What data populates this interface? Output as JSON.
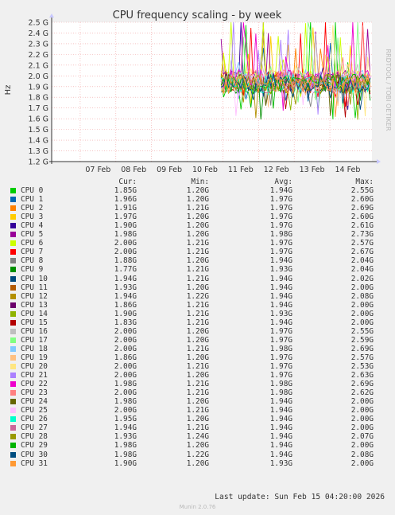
{
  "chart_data": {
    "type": "line",
    "title": "CPU frequency scaling - by week",
    "ylabel": "Hz",
    "side_text": "RRDTOOL / TOBI OETIKER",
    "x_ticks": [
      "07 Feb",
      "08 Feb",
      "09 Feb",
      "10 Feb",
      "11 Feb",
      "12 Feb",
      "13 Feb",
      "14 Feb"
    ],
    "y_ticks": [
      "1.2 G",
      "1.3 G",
      "1.4 G",
      "1.5 G",
      "1.6 G",
      "1.7 G",
      "1.8 G",
      "1.9 G",
      "2.0 G",
      "2.1 G",
      "2.2 G",
      "2.3 G",
      "2.4 G",
      "2.5 G"
    ],
    "ylim": [
      1.2,
      2.5
    ],
    "xlim_days": [
      6.2,
      15.18
    ],
    "data_start_day": 10.95,
    "grid": true,
    "series": [
      {
        "name": "CPU 0",
        "color": "#00cc00",
        "cur": "1.85G",
        "min": "1.20G",
        "avg": "1.94G",
        "max": "2.55G"
      },
      {
        "name": "CPU 1",
        "color": "#0066b3",
        "cur": "1.96G",
        "min": "1.20G",
        "avg": "1.97G",
        "max": "2.60G"
      },
      {
        "name": "CPU 2",
        "color": "#ff8000",
        "cur": "1.91G",
        "min": "1.21G",
        "avg": "1.97G",
        "max": "2.69G"
      },
      {
        "name": "CPU 3",
        "color": "#ffcc00",
        "cur": "1.97G",
        "min": "1.20G",
        "avg": "1.97G",
        "max": "2.60G"
      },
      {
        "name": "CPU 4",
        "color": "#330099",
        "cur": "1.90G",
        "min": "1.20G",
        "avg": "1.97G",
        "max": "2.61G"
      },
      {
        "name": "CPU 5",
        "color": "#990099",
        "cur": "1.98G",
        "min": "1.20G",
        "avg": "1.98G",
        "max": "2.73G"
      },
      {
        "name": "CPU 6",
        "color": "#ccff00",
        "cur": "2.00G",
        "min": "1.21G",
        "avg": "1.97G",
        "max": "2.57G"
      },
      {
        "name": "CPU 7",
        "color": "#ff0000",
        "cur": "2.00G",
        "min": "1.21G",
        "avg": "1.97G",
        "max": "2.67G"
      },
      {
        "name": "CPU 8",
        "color": "#808080",
        "cur": "1.88G",
        "min": "1.20G",
        "avg": "1.94G",
        "max": "2.04G"
      },
      {
        "name": "CPU 9",
        "color": "#008f00",
        "cur": "1.77G",
        "min": "1.21G",
        "avg": "1.93G",
        "max": "2.04G"
      },
      {
        "name": "CPU 10",
        "color": "#00487d",
        "cur": "1.94G",
        "min": "1.21G",
        "avg": "1.94G",
        "max": "2.02G"
      },
      {
        "name": "CPU 11",
        "color": "#b35a00",
        "cur": "1.93G",
        "min": "1.20G",
        "avg": "1.94G",
        "max": "2.00G"
      },
      {
        "name": "CPU 12",
        "color": "#b38f00",
        "cur": "1.94G",
        "min": "1.22G",
        "avg": "1.94G",
        "max": "2.08G"
      },
      {
        "name": "CPU 13",
        "color": "#6b006b",
        "cur": "1.86G",
        "min": "1.21G",
        "avg": "1.94G",
        "max": "2.00G"
      },
      {
        "name": "CPU 14",
        "color": "#8fb300",
        "cur": "1.90G",
        "min": "1.21G",
        "avg": "1.93G",
        "max": "2.00G"
      },
      {
        "name": "CPU 15",
        "color": "#b30000",
        "cur": "1.83G",
        "min": "1.21G",
        "avg": "1.94G",
        "max": "2.00G"
      },
      {
        "name": "CPU 16",
        "color": "#bebebe",
        "cur": "2.00G",
        "min": "1.20G",
        "avg": "1.97G",
        "max": "2.55G"
      },
      {
        "name": "CPU 17",
        "color": "#80ff80",
        "cur": "2.00G",
        "min": "1.20G",
        "avg": "1.97G",
        "max": "2.59G"
      },
      {
        "name": "CPU 18",
        "color": "#80c9ff",
        "cur": "2.00G",
        "min": "1.21G",
        "avg": "1.98G",
        "max": "2.69G"
      },
      {
        "name": "CPU 19",
        "color": "#ffc080",
        "cur": "1.86G",
        "min": "1.20G",
        "avg": "1.97G",
        "max": "2.57G"
      },
      {
        "name": "CPU 20",
        "color": "#ffe680",
        "cur": "2.00G",
        "min": "1.21G",
        "avg": "1.97G",
        "max": "2.53G"
      },
      {
        "name": "CPU 21",
        "color": "#aa80ff",
        "cur": "2.00G",
        "min": "1.20G",
        "avg": "1.97G",
        "max": "2.63G"
      },
      {
        "name": "CPU 22",
        "color": "#ee00cc",
        "cur": "1.98G",
        "min": "1.21G",
        "avg": "1.98G",
        "max": "2.69G"
      },
      {
        "name": "CPU 23",
        "color": "#ff8080",
        "cur": "2.00G",
        "min": "1.21G",
        "avg": "1.98G",
        "max": "2.62G"
      },
      {
        "name": "CPU 24",
        "color": "#666600",
        "cur": "1.98G",
        "min": "1.20G",
        "avg": "1.94G",
        "max": "2.00G"
      },
      {
        "name": "CPU 25",
        "color": "#ffbfff",
        "cur": "2.00G",
        "min": "1.21G",
        "avg": "1.94G",
        "max": "2.00G"
      },
      {
        "name": "CPU 26",
        "color": "#00ffcc",
        "cur": "1.95G",
        "min": "1.20G",
        "avg": "1.94G",
        "max": "2.00G"
      },
      {
        "name": "CPU 27",
        "color": "#cc6699",
        "cur": "1.94G",
        "min": "1.21G",
        "avg": "1.94G",
        "max": "2.00G"
      },
      {
        "name": "CPU 28",
        "color": "#999900",
        "cur": "1.93G",
        "min": "1.24G",
        "avg": "1.94G",
        "max": "2.07G"
      },
      {
        "name": "CPU 29",
        "color": "#00b300",
        "cur": "1.98G",
        "min": "1.20G",
        "avg": "1.94G",
        "max": "2.00G"
      },
      {
        "name": "CPU 30",
        "color": "#004d80",
        "cur": "1.98G",
        "min": "1.22G",
        "avg": "1.94G",
        "max": "2.08G"
      },
      {
        "name": "CPU 31",
        "color": "#ff9933",
        "cur": "1.90G",
        "min": "1.20G",
        "avg": "1.93G",
        "max": "2.00G"
      }
    ]
  },
  "legend_headers": {
    "cur": "Cur:",
    "min": "Min:",
    "avg": "Avg:",
    "max": "Max:"
  },
  "last_update": "Last update: Sun Feb 15 04:20:00 2026",
  "munin_version": "Munin 2.0.76"
}
